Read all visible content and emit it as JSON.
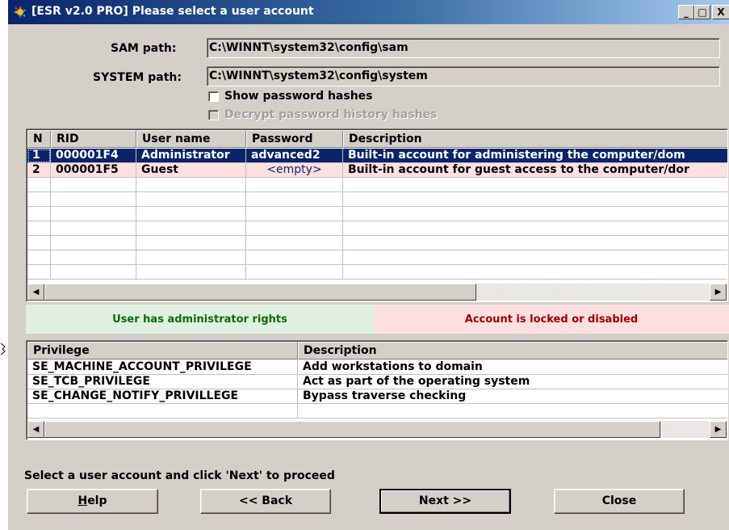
{
  "window": {
    "title": "[ESR v2.0 PRO] Please select a user account",
    "minimize_glyph": "_",
    "maximize_glyph": "□",
    "close_glyph": "X"
  },
  "paths": {
    "sam_label": "SAM path:",
    "sam_value": "C:\\WINNT\\system32\\config\\sam",
    "system_label": "SYSTEM path:",
    "system_value": "C:\\WINNT\\system32\\config\\system"
  },
  "options": {
    "show_hashes_label": "Show password hashes",
    "decrypt_history_label": "Decrypt password history hashes"
  },
  "accounts": {
    "columns": [
      "N",
      "RID",
      "User name",
      "Password",
      "Description"
    ],
    "rows": [
      {
        "n": "1",
        "rid": "000001F4",
        "user": "Administrator",
        "password": "advanced2",
        "description": "Built-in account for administering the computer/dom"
      },
      {
        "n": "2",
        "rid": "000001F5",
        "user": "Guest",
        "password": "<empty>",
        "description": "Built-in account for guest access to the computer/dor"
      }
    ]
  },
  "legend": {
    "admin": "User has administrator rights",
    "locked": "Account is locked or disabled"
  },
  "privileges": {
    "columns": [
      "Privilege",
      "Description"
    ],
    "rows": [
      {
        "privilege": "SE_MACHINE_ACCOUNT_PRIVILEGE",
        "description": "Add workstations to domain"
      },
      {
        "privilege": "SE_TCB_PRIVILEGE",
        "description": "Act as part of the operating system"
      },
      {
        "privilege": "SE_CHANGE_NOTIFY_PRIVILLEGE",
        "description": "Bypass traverse checking"
      }
    ]
  },
  "status_text": "Select a user account and click 'Next' to proceed",
  "buttons": {
    "help_prefix": "H",
    "help_rest": "elp",
    "back": "<< Back",
    "next": "Next >>",
    "close": "Close"
  },
  "icons": {
    "scroll_left": "◀",
    "scroll_right": "▶"
  },
  "colors": {
    "selected_row": "#0a246a",
    "locked_row": "#ffe0e0",
    "admin_legend": "#e0f0e0"
  }
}
